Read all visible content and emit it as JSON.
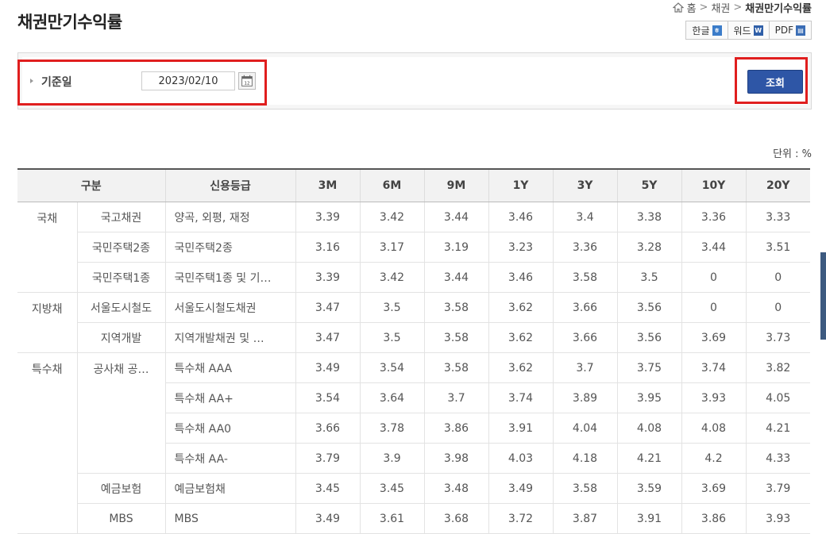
{
  "page": {
    "title": "채권만기수익률"
  },
  "breadcrumb": {
    "home": "홈",
    "sep1": ">",
    "level1": "채권",
    "sep2": ">",
    "current": "채권만기수익률"
  },
  "export": {
    "hwp": "한글",
    "word": "워드",
    "pdf": "PDF",
    "hwp_icon": "hwp-file-icon",
    "word_icon": "word-file-icon",
    "pdf_icon": "pdf-file-icon"
  },
  "search": {
    "date_label": "기준일",
    "date_value": "2023/02/10",
    "calendar_icon": "calendar-icon",
    "button_label": "조회",
    "button_color": "#2e56a6",
    "highlight_color": "#e01e1e"
  },
  "unit_label": "단위 : %",
  "table": {
    "headers": {
      "group": "구분",
      "grade": "신용등급",
      "m3": "3M",
      "m6": "6M",
      "m9": "9M",
      "y1": "1Y",
      "y3": "3Y",
      "y5": "5Y",
      "y10": "10Y",
      "y20": "20Y"
    },
    "rows": [
      {
        "cat": "국채",
        "sub": "국고채권",
        "grade": "양곡, 외평, 재정",
        "v": [
          "3.39",
          "3.42",
          "3.44",
          "3.46",
          "3.4",
          "3.38",
          "3.36",
          "3.33"
        ]
      },
      {
        "sub": "국민주택2종",
        "grade": "국민주택2종",
        "v": [
          "3.16",
          "3.17",
          "3.19",
          "3.23",
          "3.36",
          "3.28",
          "3.44",
          "3.51"
        ]
      },
      {
        "sub": "국민주택1종",
        "grade": "국민주택1종 및 기…",
        "v": [
          "3.39",
          "3.42",
          "3.44",
          "3.46",
          "3.58",
          "3.5",
          "0",
          "0"
        ]
      },
      {
        "cat": "지방채",
        "sub": "서울도시철도",
        "grade": "서울도시철도채권",
        "v": [
          "3.47",
          "3.5",
          "3.58",
          "3.62",
          "3.66",
          "3.56",
          "0",
          "0"
        ]
      },
      {
        "sub": "지역개발",
        "grade": "지역개발채권 및 …",
        "v": [
          "3.47",
          "3.5",
          "3.58",
          "3.62",
          "3.66",
          "3.56",
          "3.69",
          "3.73"
        ]
      },
      {
        "cat": "특수채",
        "sub": "공사채 공…",
        "grade": "특수채 AAA",
        "v": [
          "3.49",
          "3.54",
          "3.58",
          "3.62",
          "3.7",
          "3.75",
          "3.74",
          "3.82"
        ]
      },
      {
        "grade": "특수채 AA+",
        "v": [
          "3.54",
          "3.64",
          "3.7",
          "3.74",
          "3.89",
          "3.95",
          "3.93",
          "4.05"
        ]
      },
      {
        "grade": "특수채 AA0",
        "v": [
          "3.66",
          "3.78",
          "3.86",
          "3.91",
          "4.04",
          "4.08",
          "4.08",
          "4.21"
        ]
      },
      {
        "grade": "특수채 AA-",
        "v": [
          "3.79",
          "3.9",
          "3.98",
          "4.03",
          "4.18",
          "4.21",
          "4.2",
          "4.33"
        ]
      },
      {
        "sub": "예금보험",
        "grade": "예금보험채",
        "v": [
          "3.45",
          "3.45",
          "3.48",
          "3.49",
          "3.58",
          "3.59",
          "3.69",
          "3.79"
        ]
      },
      {
        "sub": "MBS",
        "grade": "MBS",
        "v": [
          "3.49",
          "3.61",
          "3.68",
          "3.72",
          "3.87",
          "3.91",
          "3.86",
          "3.93"
        ]
      }
    ]
  }
}
